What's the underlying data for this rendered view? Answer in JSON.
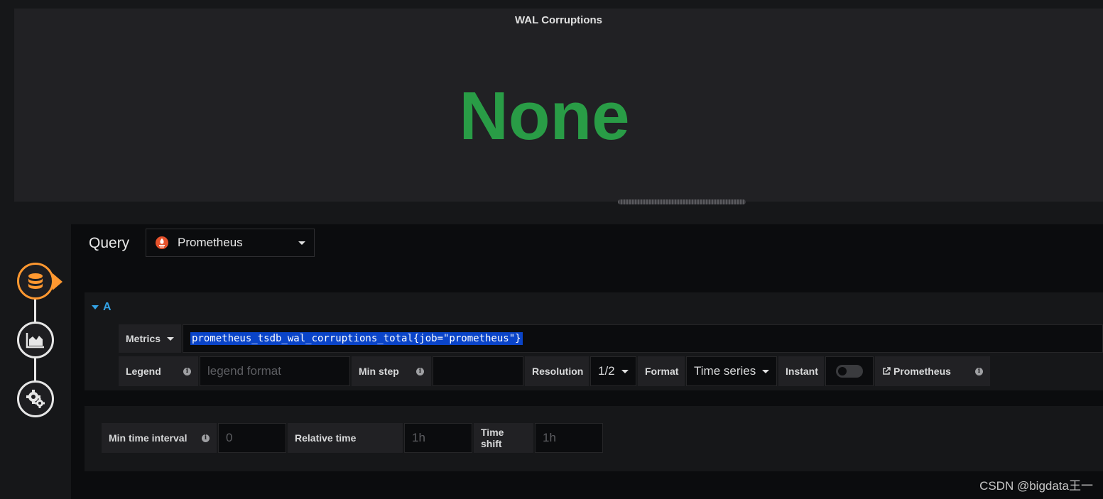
{
  "panel": {
    "title": "WAL Corruptions",
    "value": "None",
    "value_color": "#299c46"
  },
  "editor": {
    "query_label": "Query",
    "datasource": {
      "name": "Prometheus",
      "icon": "prometheus-icon",
      "accent": "#e6522c"
    },
    "rail": [
      {
        "icon": "database-icon",
        "active": true
      },
      {
        "icon": "chart-area-icon",
        "active": false
      },
      {
        "icon": "settings-icon",
        "active": false
      }
    ],
    "query_a": {
      "ref_id": "A",
      "metrics_label": "Metrics",
      "expression": "prometheus_tsdb_wal_corruptions_total{job=\"prometheus\"}",
      "legend_label": "Legend",
      "legend_placeholder": "legend format",
      "min_step_label": "Min step",
      "min_step_value": "",
      "resolution_label": "Resolution",
      "resolution_value": "1/2",
      "format_label": "Format",
      "format_value": "Time series",
      "instant_label": "Instant",
      "instant_on": false,
      "link_label": "Prometheus"
    },
    "options": {
      "min_interval_label": "Min time interval",
      "min_interval_placeholder": "0",
      "relative_time_label": "Relative time",
      "relative_time_placeholder": "1h",
      "time_shift_label": "Time shift",
      "time_shift_placeholder": "1h"
    }
  },
  "watermark": "CSDN @bigdata王一"
}
